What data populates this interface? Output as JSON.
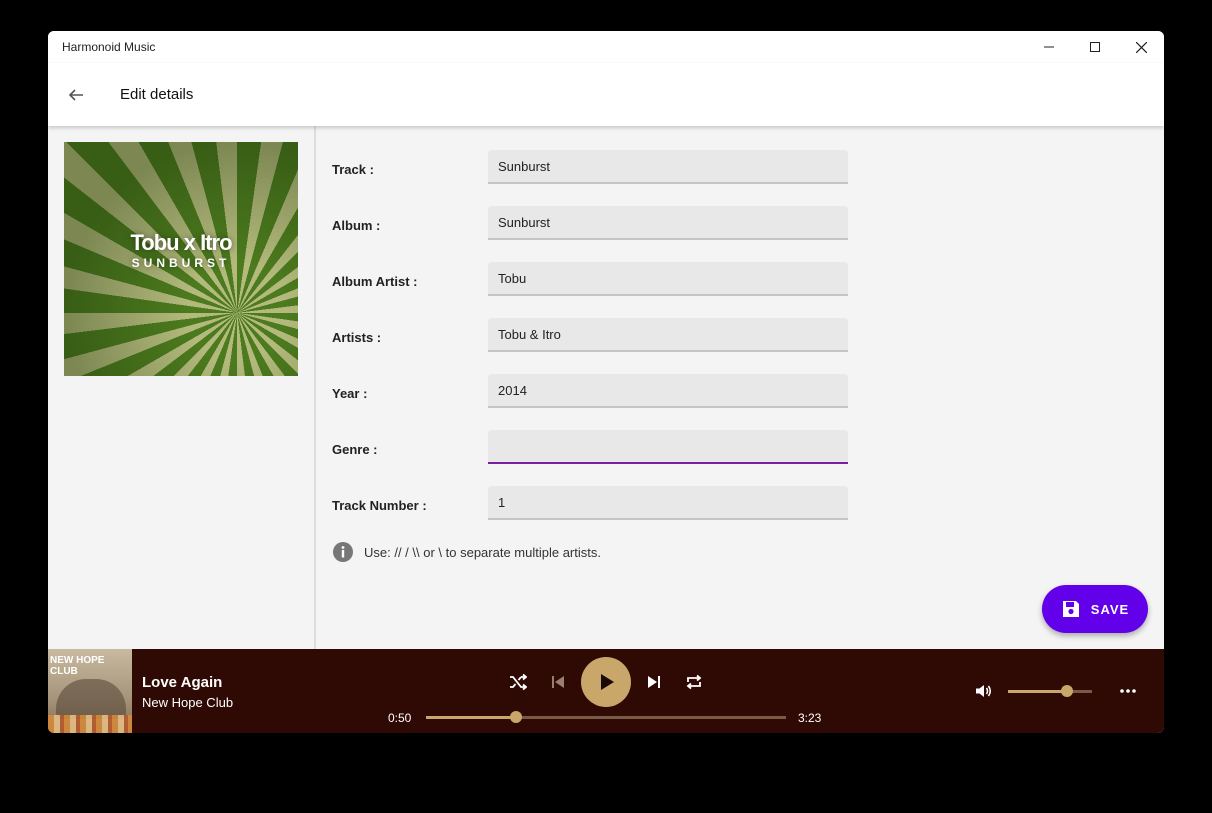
{
  "window": {
    "title": "Harmonoid Music"
  },
  "appbar": {
    "title": "Edit details",
    "back_icon": "arrow-left-icon"
  },
  "album_art": {
    "logo_text": "Tobu x Itro",
    "subtitle": "SUNBURST"
  },
  "form": {
    "fields": [
      {
        "label": "Track :",
        "value": "Sunburst"
      },
      {
        "label": "Album :",
        "value": "Sunburst"
      },
      {
        "label": "Album Artist :",
        "value": "Tobu"
      },
      {
        "label": "Artists :",
        "value": "Tobu & Itro"
      },
      {
        "label": "Year :",
        "value": "2014"
      },
      {
        "label": "Genre :",
        "value": ""
      },
      {
        "label": "Track Number :",
        "value": "1"
      }
    ],
    "hint": "Use: // / \\\\ or \\ to separate multiple artists.",
    "focused_field": "Genre :"
  },
  "save_button": {
    "label": "SAVE",
    "icon": "floppy-disk-icon",
    "color": "#6200ea"
  },
  "player": {
    "thumb_text": "NEW HOPE CLUB",
    "title": "Love Again",
    "artist": "New Hope Club",
    "elapsed": "0:50",
    "duration": "3:23",
    "progress_fraction": 0.25,
    "volume_fraction": 0.7,
    "accent": "#c9a669",
    "background": "#2f0a05"
  }
}
